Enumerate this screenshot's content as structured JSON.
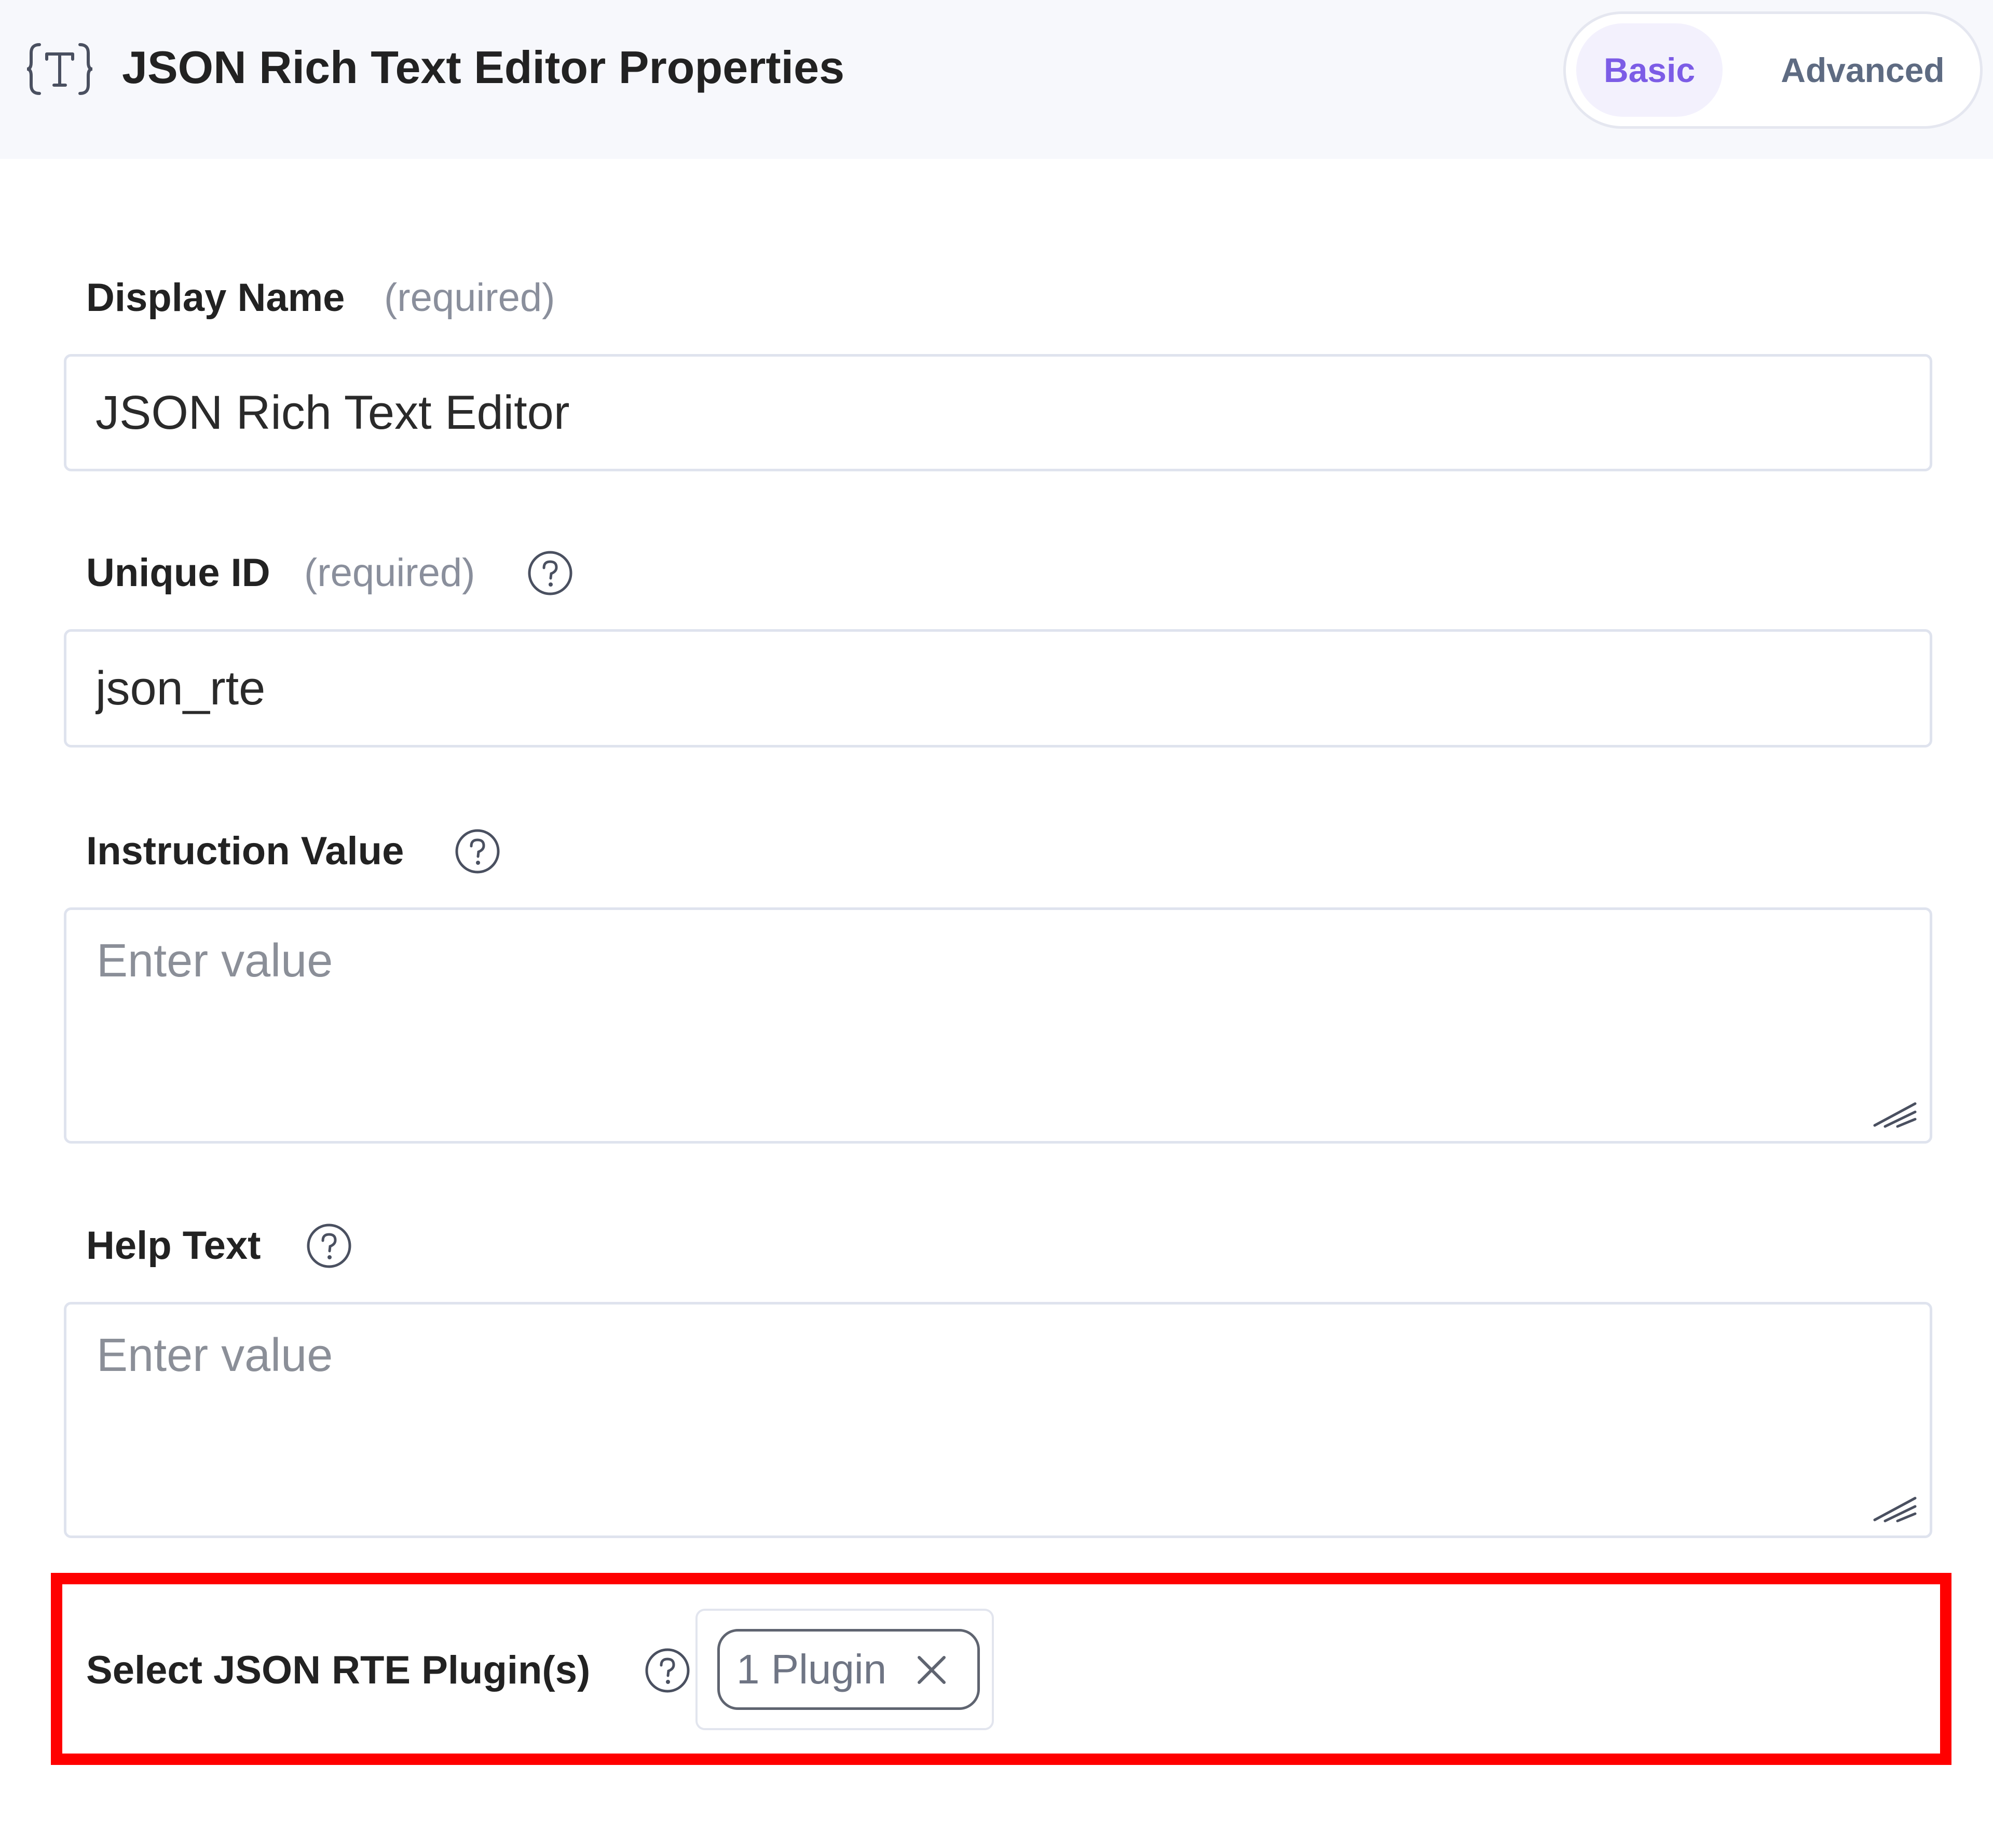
{
  "header": {
    "icon": "rich-text-json-icon",
    "title": "JSON Rich Text Editor Properties",
    "tabs": [
      {
        "label": "Basic",
        "active": true
      },
      {
        "label": "Advanced",
        "active": false
      }
    ]
  },
  "fields": {
    "display_name": {
      "label": "Display Name",
      "required_text": "(required)",
      "value": "JSON Rich Text Editor"
    },
    "unique_id": {
      "label": "Unique ID",
      "required_text": "(required)",
      "help_icon": "question-circle-icon",
      "value": "json_rte"
    },
    "instruction_value": {
      "label": "Instruction Value",
      "help_icon": "question-circle-icon",
      "placeholder": "Enter value"
    },
    "help_text": {
      "label": "Help Text",
      "help_icon": "question-circle-icon",
      "placeholder": "Enter value"
    },
    "plugins": {
      "label": "Select JSON RTE Plugin(s)",
      "help_icon": "question-circle-icon",
      "selected_text": "1 Plugin",
      "remove_icon": "close-icon"
    }
  },
  "colors": {
    "accent": "#7c5ce6",
    "highlight": "#ff0000",
    "header_bg": "#f7f8fc",
    "border": "#dfe3ee"
  }
}
